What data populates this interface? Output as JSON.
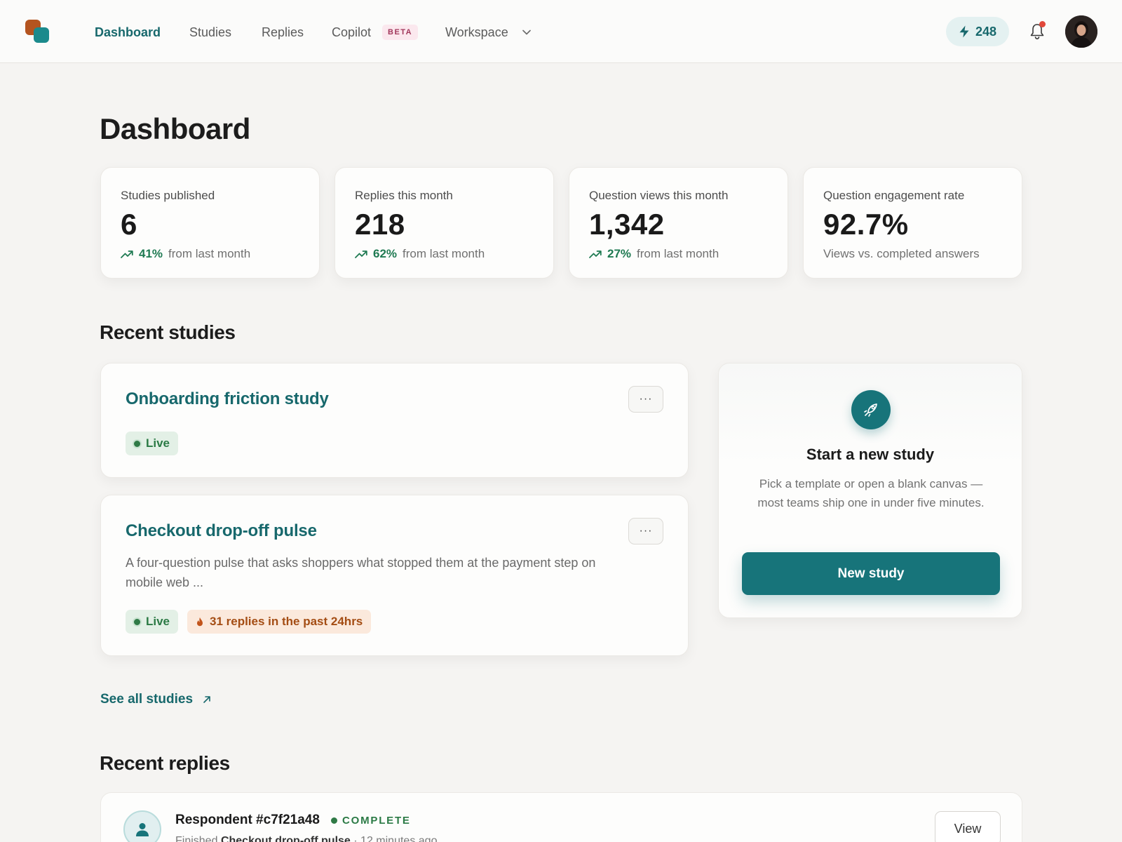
{
  "nav": {
    "items": [
      {
        "label": "Dashboard",
        "active": true
      },
      {
        "label": "Studies"
      },
      {
        "label": "Replies"
      },
      {
        "label": "Copilot",
        "badge": "BETA"
      },
      {
        "label": "Workspace",
        "has_dropdown": true
      }
    ],
    "credits": "248",
    "bell_has_notification": true
  },
  "page": {
    "title": "Dashboard"
  },
  "stats": [
    {
      "label": "Studies published",
      "value": "6",
      "pct": "41%",
      "suffix": "from last month"
    },
    {
      "label": "Replies this month",
      "value": "218",
      "pct": "62%",
      "suffix": "from last month"
    },
    {
      "label": "Question views this month",
      "value": "1,342",
      "pct": "27%",
      "suffix": "from last month"
    },
    {
      "label": "Question engagement rate",
      "value": "92.7%",
      "note": "Views vs. completed answers"
    }
  ],
  "recent_studies": {
    "heading": "Recent studies",
    "items": [
      {
        "title": "Onboarding friction study",
        "status": "Live",
        "more": "···"
      },
      {
        "title": "Checkout drop-off pulse",
        "description": "A four-question pulse that asks shoppers what stopped them at the payment step on mobile web ...",
        "status": "Live",
        "activity": "31 replies in the past 24hrs",
        "more": "···"
      }
    ],
    "see_all": "See all studies"
  },
  "new_study": {
    "title": "Start a new study",
    "description": "Pick a template or open a blank canvas — most teams ship one in under five minutes.",
    "button": "New study"
  },
  "recent_replies": {
    "heading": "Recent replies",
    "items": [
      {
        "name": "Respondent #c7f21a48",
        "status": "COMPLETE",
        "prefix": "Finished",
        "study": "Checkout drop-off pulse",
        "time": "· 12 minutes ago",
        "action": "View"
      }
    ]
  },
  "colors": {
    "accent": "#17747a",
    "brand_orange": "#b4541f",
    "success": "#2b7a45",
    "hot": "#a44d14",
    "beta": "#a2385c"
  }
}
